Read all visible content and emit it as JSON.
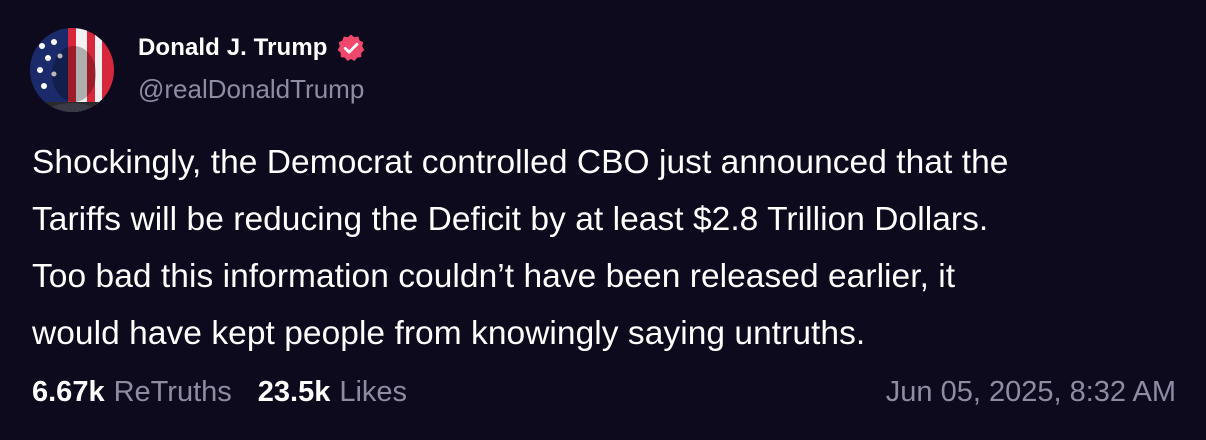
{
  "post": {
    "author": {
      "display_name": "Donald J. Trump",
      "handle": "@realDonaldTrump",
      "verified": true,
      "verified_icon": "verified-badge-icon",
      "avatar": "profile-avatar"
    },
    "text_lines": [
      "Shockingly, the Democrat controlled CBO just announced that the",
      "Tariffs will be reducing the Deficit by at least $2.8 Trillion Dollars.",
      "Too bad this information couldn’t have been released earlier, it",
      "would have kept people from knowingly saying untruths."
    ],
    "stats": {
      "retruths_count": "6.67k",
      "retruths_label": "ReTruths",
      "likes_count": "23.5k",
      "likes_label": "Likes"
    },
    "timestamp": "Jun 05, 2025, 8:32 AM"
  },
  "colors": {
    "background": "#0c0a1c",
    "text_primary": "#ffffff",
    "text_secondary": "#8e8ca3",
    "verified_badge": "#f0486d"
  }
}
